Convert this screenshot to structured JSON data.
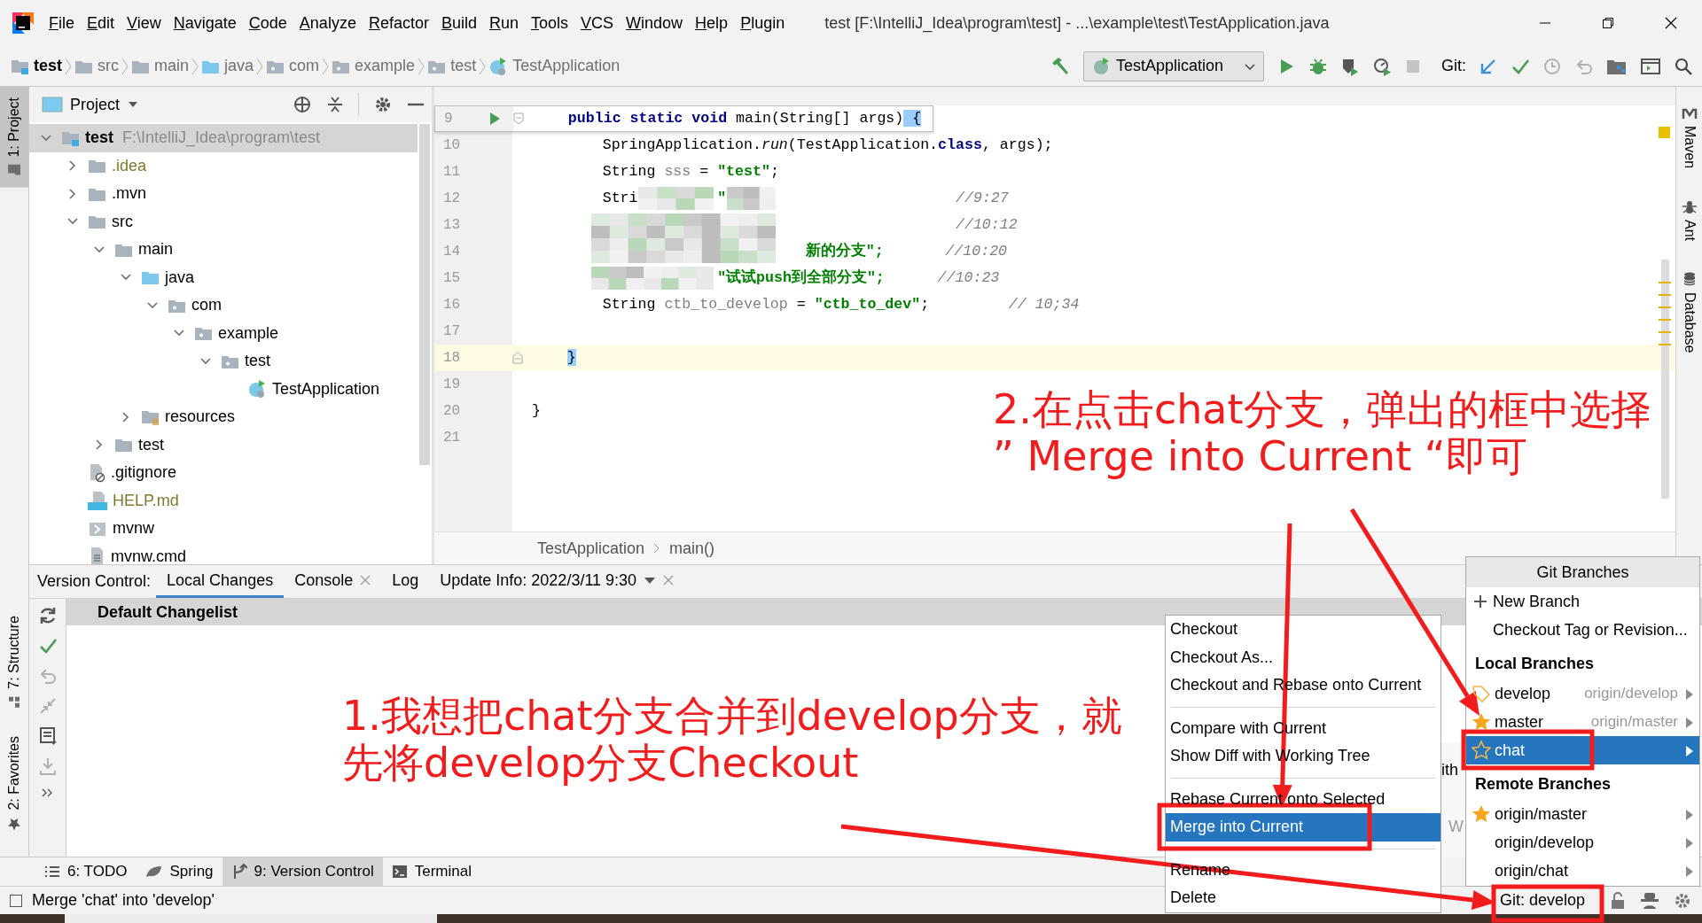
{
  "menu_bar": {
    "items": [
      "File",
      "Edit",
      "View",
      "Navigate",
      "Code",
      "Analyze",
      "Refactor",
      "Build",
      "Run",
      "Tools",
      "VCS",
      "Window",
      "Help",
      "Plugin"
    ],
    "title": "test [F:\\IntelliJ_Idea\\program\\test] - ...\\example\\test\\TestApplication.java"
  },
  "nav_bar": {
    "breadcrumbs": [
      {
        "label": "test",
        "kind": "module"
      },
      {
        "label": "src",
        "kind": "folder"
      },
      {
        "label": "main",
        "kind": "folder"
      },
      {
        "label": "java",
        "kind": "source"
      },
      {
        "label": "com",
        "kind": "package"
      },
      {
        "label": "example",
        "kind": "package"
      },
      {
        "label": "test",
        "kind": "package"
      },
      {
        "label": "TestApplication",
        "kind": "class"
      }
    ],
    "run_config": "TestApplication",
    "git_label": "Git:"
  },
  "left_stripe": {
    "top": [
      {
        "label": "1: Project",
        "selected": true,
        "kind": "folder"
      }
    ],
    "bottom": [
      {
        "label": "7: Structure",
        "selected": false,
        "kind": "structure"
      },
      {
        "label": "2: Favorites",
        "selected": false,
        "kind": "star"
      }
    ]
  },
  "right_stripe": [
    {
      "label": "Maven",
      "kind": "maven"
    },
    {
      "label": "Ant",
      "kind": "ant"
    },
    {
      "label": "Database",
      "kind": "database"
    }
  ],
  "project": {
    "title": "Project",
    "tree": [
      {
        "label": "test",
        "path": "F:\\IntelliJ_Idea\\program\\test",
        "kind": "module",
        "expanded": true,
        "selected": true,
        "children": [
          {
            "label": ".idea",
            "kind": "folder",
            "expanded": false,
            "selected": false,
            "color": "#80792f"
          },
          {
            "label": ".mvn",
            "kind": "folder",
            "expanded": false,
            "selected": false
          },
          {
            "label": "src",
            "kind": "folder",
            "expanded": true,
            "selected": false,
            "children": [
              {
                "label": "main",
                "kind": "folder",
                "expanded": true,
                "selected": false,
                "children": [
                  {
                    "label": "java",
                    "kind": "source",
                    "expanded": true,
                    "selected": false,
                    "children": [
                      {
                        "label": "com",
                        "kind": "package",
                        "expanded": true,
                        "selected": false,
                        "children": [
                          {
                            "label": "example",
                            "kind": "package",
                            "expanded": true,
                            "selected": false,
                            "children": [
                              {
                                "label": "test",
                                "kind": "package",
                                "expanded": true,
                                "selected": false,
                                "children": [
                                  {
                                    "label": "TestApplication",
                                    "kind": "class",
                                    "selected": false
                                  }
                                ]
                              }
                            ]
                          }
                        ]
                      }
                    ]
                  },
                  {
                    "label": "resources",
                    "kind": "resources",
                    "expanded": false,
                    "selected": false
                  }
                ]
              },
              {
                "label": "test",
                "kind": "folder",
                "expanded": false,
                "selected": false
              }
            ]
          },
          {
            "label": ".gitignore",
            "kind": "gitignore",
            "selected": false
          },
          {
            "label": "HELP.md",
            "kind": "markdown",
            "selected": false,
            "color": "#80792f"
          },
          {
            "label": "mvnw",
            "kind": "exec",
            "selected": false
          },
          {
            "label": "mvnw.cmd",
            "kind": "textfile",
            "selected": false
          }
        ]
      }
    ]
  },
  "editor": {
    "sticky_line": {
      "number": "9",
      "run": true,
      "kind": "fold-start",
      "tokens": [
        {
          "kind": "kw",
          "text": "    public static void"
        },
        {
          "kind": "plain",
          "text": " main(String[] args)"
        },
        {
          "kind": "brace",
          "text": " {"
        }
      ]
    },
    "lines": [
      {
        "number": "10",
        "current": false,
        "kind": "code",
        "tokens": [
          {
            "kind": "plain",
            "text": "        SpringApplication."
          },
          {
            "kind": "italic",
            "text": "run"
          },
          {
            "kind": "plain",
            "text": "(TestApplication."
          },
          {
            "kind": "kw",
            "text": "class"
          },
          {
            "kind": "plain",
            "text": ", args);"
          }
        ]
      },
      {
        "number": "11",
        "current": false,
        "kind": "code",
        "tokens": [
          {
            "kind": "plain",
            "text": "        String"
          },
          {
            "kind": "unused",
            "text": " sss"
          },
          {
            "kind": "plain",
            "text": " = "
          },
          {
            "kind": "str",
            "text": "\"test\""
          },
          {
            "kind": "plain",
            "text": ";"
          }
        ]
      },
      {
        "number": "12",
        "current": false,
        "kind": "code",
        "tokens": [
          {
            "kind": "plain",
            "text": "        Stri"
          },
          {
            "kind": "str",
            "text": "         \""
          },
          {
            "kind": "comment",
            "text": "                          //9:27"
          }
        ]
      },
      {
        "number": "13",
        "current": false,
        "kind": "code",
        "tokens": [
          {
            "kind": "comment",
            "text": "                                                //10:12"
          }
        ]
      },
      {
        "number": "14",
        "current": false,
        "kind": "code",
        "tokens": [
          {
            "kind": "str",
            "text": "                               新的分支\";"
          },
          {
            "kind": "comment",
            "text": "       //10:20"
          }
        ]
      },
      {
        "number": "15",
        "current": false,
        "kind": "code",
        "tokens": [
          {
            "kind": "str",
            "text": "                     \"试试push到全部分支\";"
          },
          {
            "kind": "comment",
            "text": "      //10:23"
          }
        ]
      },
      {
        "number": "16",
        "current": false,
        "kind": "code",
        "tokens": [
          {
            "kind": "plain",
            "text": "        String"
          },
          {
            "kind": "unused",
            "text": " ctb_to_develop"
          },
          {
            "kind": "plain",
            "text": " = "
          },
          {
            "kind": "str",
            "text": "\"ctb_to_dev\""
          },
          {
            "kind": "plain",
            "text": ";"
          },
          {
            "kind": "comment",
            "text": "         // 10;34"
          }
        ]
      },
      {
        "number": "17",
        "current": false,
        "kind": "code"
      },
      {
        "number": "18",
        "current": true,
        "kind": "fold-end",
        "tokens": [
          {
            "kind": "brace",
            "text": "    }"
          }
        ]
      },
      {
        "number": "19",
        "current": false,
        "kind": "code"
      },
      {
        "number": "20",
        "current": false,
        "kind": "code",
        "tokens": [
          {
            "kind": "plain",
            "text": "}"
          }
        ]
      },
      {
        "number": "21",
        "current": false,
        "kind": "code"
      }
    ],
    "breadcrumbs": [
      "TestApplication",
      "main()"
    ]
  },
  "bottom_panel": {
    "label": "Version Control:",
    "tabs": [
      {
        "label": "Local Changes",
        "selected": true,
        "closable": false,
        "dropdown": false
      },
      {
        "label": "Console",
        "selected": false,
        "closable": true,
        "dropdown": false
      },
      {
        "label": "Log",
        "selected": false,
        "closable": false,
        "dropdown": false
      },
      {
        "label": "Update Info: 2022/3/11 9:30",
        "selected": false,
        "closable": true,
        "dropdown": true
      }
    ],
    "changelist": "Default Changelist"
  },
  "tool_tabs": [
    {
      "label": "6: TODO",
      "kind": "list",
      "selected": false
    },
    {
      "label": "Spring",
      "kind": "leaf",
      "selected": false
    },
    {
      "label": "9: Version Control",
      "kind": "branch",
      "selected": true
    },
    {
      "label": "Terminal",
      "kind": "terminal",
      "selected": false
    }
  ],
  "status_bar": {
    "message": "Merge 'chat' into 'develop'",
    "git": "Git: develop"
  },
  "context_menu": {
    "groups": [
      [
        {
          "label": "Checkout",
          "selected": false
        },
        {
          "label": "Checkout As...",
          "selected": false
        },
        {
          "label": "Checkout and Rebase onto Current",
          "selected": false
        }
      ],
      [
        {
          "label": "Compare with Current",
          "selected": false
        },
        {
          "label": "Show Diff with Working Tree",
          "selected": false
        }
      ],
      [
        {
          "label": "Rebase Current onto Selected",
          "selected": false
        },
        {
          "label": "Merge into Current",
          "selected": true
        }
      ],
      [
        {
          "label": "Rename",
          "selected": false
        },
        {
          "label": "Delete",
          "selected": false
        }
      ]
    ]
  },
  "background_fragments": [
    "ith",
    "W"
  ],
  "branches_popup": {
    "title": "Git Branches",
    "actions": [
      {
        "label": "New Branch",
        "kind": "plus"
      },
      {
        "label": "Checkout Tag or Revision...",
        "kind": "plain"
      }
    ],
    "sections": [
      {
        "title": "Local Branches",
        "branches": [
          {
            "name": "develop",
            "remote": "origin/develop",
            "current": true,
            "favorite": false,
            "selected": false
          },
          {
            "name": "master",
            "remote": "origin/master",
            "current": false,
            "favorite": true,
            "selected": false
          },
          {
            "name": "chat",
            "current": false,
            "favorite": false,
            "selected": true
          }
        ]
      },
      {
        "title": "Remote Branches",
        "branches": [
          {
            "name": "origin/master",
            "current": false,
            "favorite": true,
            "selected": false
          },
          {
            "name": "origin/develop",
            "current": false,
            "favorite": false,
            "selected": false
          },
          {
            "name": "origin/chat",
            "current": false,
            "favorite": false,
            "selected": false
          }
        ]
      }
    ]
  },
  "annotations": {
    "notes": [
      {
        "lines": [
          "1.我想把chat分支合并到develop分支，就",
          "先将develop分支Checkout"
        ]
      },
      {
        "lines": [
          "2.在点击chat分支，弹出的框中选择",
          "” Merge into Current “即可"
        ]
      }
    ]
  }
}
